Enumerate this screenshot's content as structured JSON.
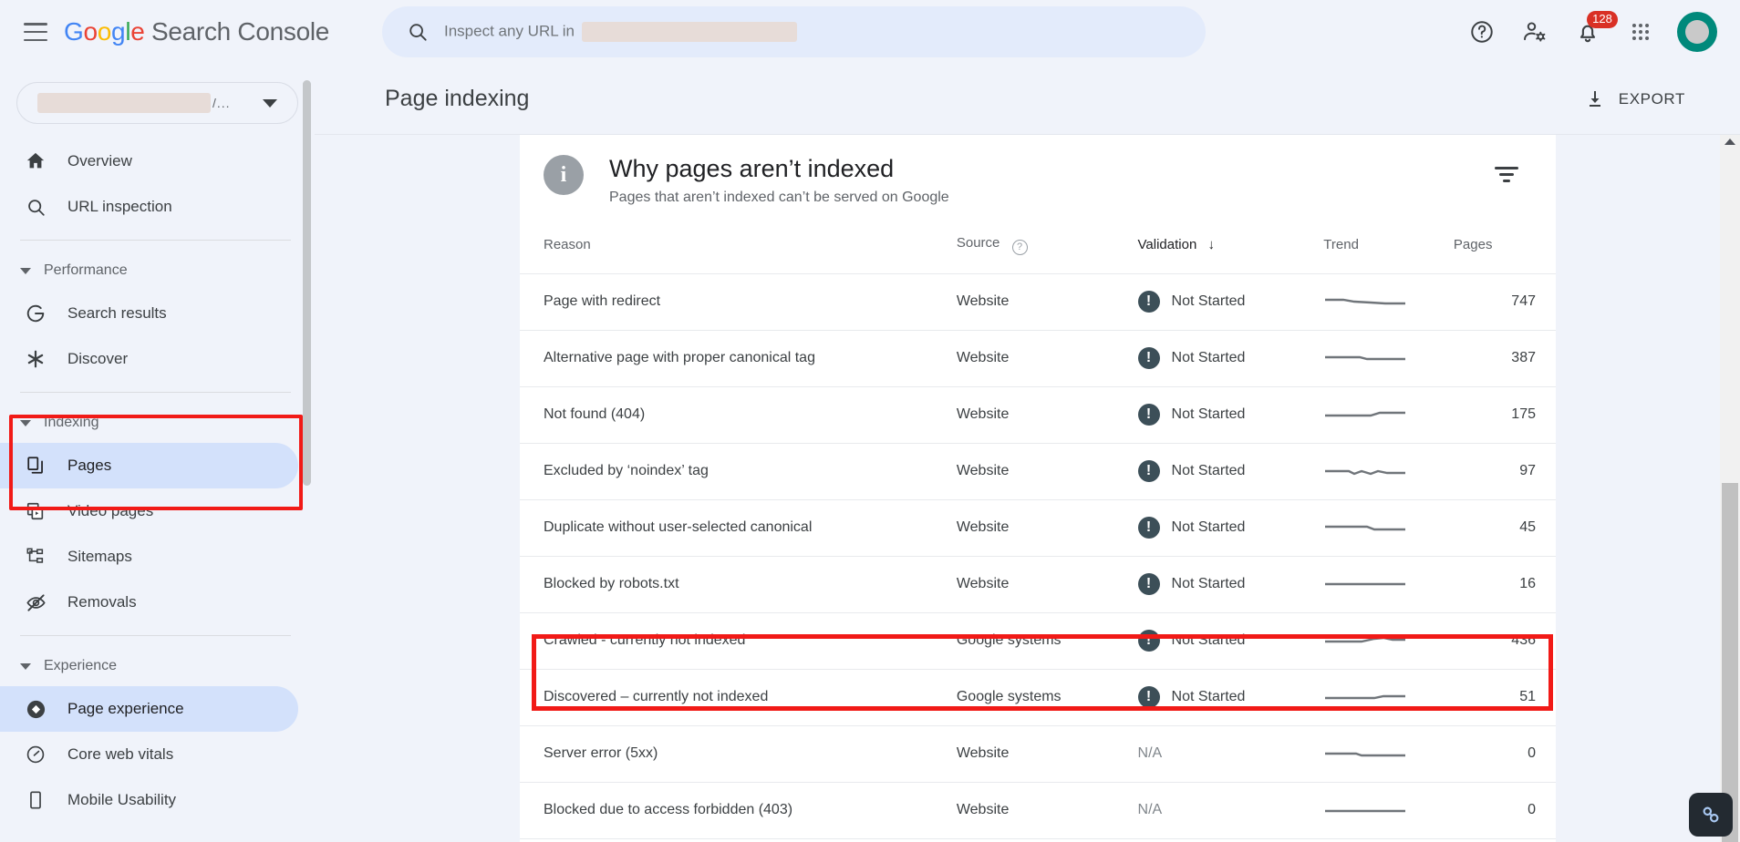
{
  "topbar": {
    "menu_icon": "hamburger-menu-icon",
    "brand": {
      "google": "Google",
      "product": "Search Console"
    },
    "search": {
      "icon": "search-icon",
      "placeholder_prefix": "Inspect any URL in",
      "value": ""
    },
    "icons": {
      "help": "help-circle-icon",
      "account_settings": "person-gear-icon",
      "notifications": "bell-icon",
      "apps": "apps-grid-icon",
      "avatar": "avatar"
    },
    "notification_count": "128"
  },
  "sidebar": {
    "property": {
      "name": "",
      "suffix": "/...",
      "caret": "chevron-down-icon"
    },
    "items": [
      {
        "label": "Overview",
        "icon": "home-icon",
        "type": "item",
        "active": false
      },
      {
        "label": "URL inspection",
        "icon": "search-icon",
        "type": "item",
        "active": false
      },
      {
        "label": "Performance",
        "icon": "chevron-down-icon",
        "type": "group",
        "active": false
      },
      {
        "label": "Search results",
        "icon": "google-g-icon",
        "type": "item",
        "active": false
      },
      {
        "label": "Discover",
        "icon": "asterisk-icon",
        "type": "item",
        "active": false
      },
      {
        "label": "Indexing",
        "icon": "chevron-down-icon",
        "type": "group",
        "active": false
      },
      {
        "label": "Pages",
        "icon": "pages-copy-icon",
        "type": "item",
        "active": true
      },
      {
        "label": "Video pages",
        "icon": "video-pages-icon",
        "type": "item",
        "active": false
      },
      {
        "label": "Sitemaps",
        "icon": "sitemap-icon",
        "type": "item",
        "active": false
      },
      {
        "label": "Removals",
        "icon": "eye-off-icon",
        "type": "item",
        "active": false
      },
      {
        "label": "Experience",
        "icon": "chevron-down-icon",
        "type": "group",
        "active": false
      },
      {
        "label": "Page experience",
        "icon": "page-experience-icon",
        "type": "item",
        "active": true
      },
      {
        "label": "Core web vitals",
        "icon": "speedometer-icon",
        "type": "item",
        "active": false
      },
      {
        "label": "Mobile Usability",
        "icon": "mobile-phone-icon",
        "type": "item",
        "active": false
      }
    ]
  },
  "page": {
    "title": "Page indexing",
    "export_label": "EXPORT",
    "export_icon": "download-icon"
  },
  "card": {
    "info_icon": "info-icon",
    "title": "Why pages aren’t indexed",
    "subtitle": "Pages that aren’t indexed can’t be served on Google",
    "filter_icon": "filter-icon"
  },
  "table": {
    "columns": [
      {
        "label": "Reason",
        "key": "reason",
        "help": false,
        "sorted": false
      },
      {
        "label": "Source",
        "key": "source",
        "help": true,
        "sorted": false
      },
      {
        "label": "Validation",
        "key": "validation",
        "help": false,
        "sorted": true,
        "sort_dir": "↓"
      },
      {
        "label": "Trend",
        "key": "trend",
        "help": false,
        "sorted": false
      },
      {
        "label": "Pages",
        "key": "pages",
        "help": false,
        "sorted": false
      }
    ],
    "source_help_icon": "help-circle-icon",
    "status_icon": "warning-exclamation-icon",
    "rows": [
      {
        "reason": "Page with redirect",
        "source": "Website",
        "validation": "Not Started",
        "has_status_icon": true,
        "pages": "747",
        "highlighted": false
      },
      {
        "reason": "Alternative page with proper canonical tag",
        "source": "Website",
        "validation": "Not Started",
        "has_status_icon": true,
        "pages": "387",
        "highlighted": false
      },
      {
        "reason": "Not found (404)",
        "source": "Website",
        "validation": "Not Started",
        "has_status_icon": true,
        "pages": "175",
        "highlighted": false
      },
      {
        "reason": "Excluded by ‘noindex’ tag",
        "source": "Website",
        "validation": "Not Started",
        "has_status_icon": true,
        "pages": "97",
        "highlighted": false
      },
      {
        "reason": "Duplicate without user-selected canonical",
        "source": "Website",
        "validation": "Not Started",
        "has_status_icon": true,
        "pages": "45",
        "highlighted": false
      },
      {
        "reason": "Blocked by robots.txt",
        "source": "Website",
        "validation": "Not Started",
        "has_status_icon": true,
        "pages": "16",
        "highlighted": false
      },
      {
        "reason": "Crawled - currently not indexed",
        "source": "Google systems",
        "validation": "Not Started",
        "has_status_icon": true,
        "pages": "436",
        "highlighted": true
      },
      {
        "reason": "Discovered – currently not indexed",
        "source": "Google systems",
        "validation": "Not Started",
        "has_status_icon": true,
        "pages": "51",
        "highlighted": true
      },
      {
        "reason": "Server error (5xx)",
        "source": "Website",
        "validation": "N/A",
        "has_status_icon": false,
        "pages": "0",
        "highlighted": false
      },
      {
        "reason": "Blocked due to access forbidden (403)",
        "source": "Website",
        "validation": "N/A",
        "has_status_icon": false,
        "pages": "0",
        "highlighted": false
      }
    ],
    "sparklines": [
      "2,10 22,10 34,12 52,13 68,14 90,14",
      "2,11 40,11 48,13 90,13",
      "2,13 52,13 62,10 90,10",
      "2,12 28,12 34,15 42,12 52,15 60,12 70,14 90,14",
      "2,11 48,11 56,14 90,14",
      "2,12 90,12",
      "2,13 42,13 56,10 66,9 76,11 90,11",
      "2,13 56,13 66,11 90,11",
      "2,12 36,12 42,14 90,14",
      "2,13 90,13"
    ]
  },
  "highlights": {
    "sidebar_box_color": "#f11a17",
    "rows_box_color": "#f11a17"
  },
  "scrollbars": {
    "sidebar": "sidebar-scrollbar",
    "browser": "browser-scrollbar"
  },
  "fab": {
    "icon": "link-chain-icon"
  },
  "colors": {
    "page_bg": "#f0f3fa",
    "card_bg": "#ffffff",
    "accent_blue": "#4285f4",
    "active_nav": "#d3e1fb",
    "badge_red": "#d93025",
    "status_icon": "#3c4f58",
    "avatar_teal": "#00897b"
  }
}
